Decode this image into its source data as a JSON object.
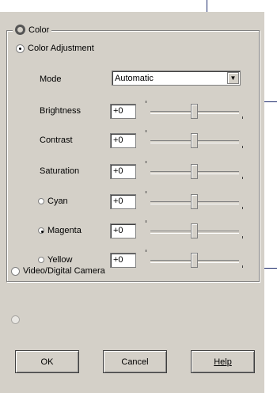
{
  "dialog": {
    "group_title": "Color",
    "color_adjustment_label": "Color Adjustment",
    "mode_label": "Mode",
    "mode_value": "Automatic",
    "sliders": [
      {
        "label": "Brightness",
        "value": "+0",
        "level": 0.5,
        "type": "label"
      },
      {
        "label": "Contrast",
        "value": "+0",
        "level": 0.5,
        "type": "label"
      },
      {
        "label": "Saturation",
        "value": "+0",
        "level": 0.5,
        "type": "label"
      },
      {
        "label": "Cyan",
        "value": "+0",
        "level": 0.5,
        "type": "radio",
        "checked": false
      },
      {
        "label": "Magenta",
        "value": "+0",
        "level": 0.5,
        "type": "radio",
        "checked": true
      },
      {
        "label": "Yellow",
        "value": "+0",
        "level": 0.5,
        "type": "radio",
        "checked": false
      }
    ],
    "video_label": "Video/Digital Camera",
    "disabled_option_label": "",
    "buttons": {
      "ok": "OK",
      "cancel": "Cancel",
      "help": "Help"
    }
  },
  "colors": {
    "face": "#d4d0c8",
    "callout": "#1c2a6b"
  }
}
